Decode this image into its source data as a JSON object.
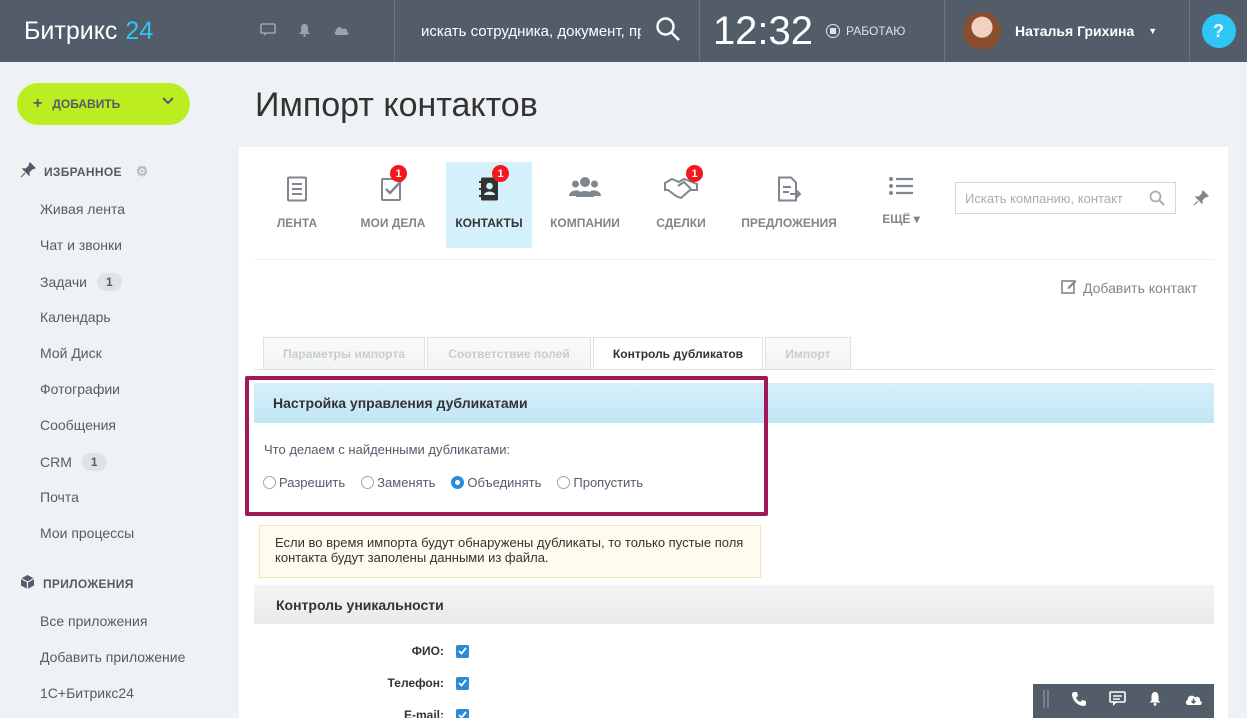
{
  "topbar": {
    "logo_text": "Битрикс",
    "logo_num": "24",
    "search_text": "искать сотрудника, документ, про",
    "time": "12:32",
    "status": "РАБОТАЮ",
    "user_name": "Наталья Грихина",
    "help": "?"
  },
  "sidebar": {
    "add_button": "ДОБАВИТЬ",
    "favorites_title": "ИЗБРАННОЕ",
    "favorites": [
      {
        "label": "Живая лента"
      },
      {
        "label": "Чат и звонки"
      },
      {
        "label": "Задачи",
        "count": "1"
      },
      {
        "label": "Календарь"
      },
      {
        "label": "Мой Диск"
      },
      {
        "label": "Фотографии"
      },
      {
        "label": "Сообщения"
      },
      {
        "label": "CRM",
        "count": "1"
      },
      {
        "label": "Почта"
      },
      {
        "label": "Мои процессы"
      }
    ],
    "apps_title": "ПРИЛОЖЕНИЯ",
    "apps": [
      {
        "label": "Все приложения"
      },
      {
        "label": "Добавить приложение"
      },
      {
        "label": "1С+Битрикс24"
      }
    ]
  },
  "page": {
    "title": "Импорт контактов"
  },
  "crm_tabs": [
    {
      "label": "ЛЕНТА"
    },
    {
      "label": "МОИ ДЕЛА",
      "badge": "1"
    },
    {
      "label": "КОНТАКТЫ",
      "badge": "1"
    },
    {
      "label": "КОМПАНИИ"
    },
    {
      "label": "СДЕЛКИ",
      "badge": "1"
    },
    {
      "label": "ПРЕДЛОЖЕНИЯ"
    },
    {
      "label": "ЕЩЁ ▾"
    }
  ],
  "crm_search_placeholder": "Искать компанию, контакт",
  "add_contact": "Добавить контакт",
  "steps": [
    {
      "label": "Параметры импорта"
    },
    {
      "label": "Соответствие полей"
    },
    {
      "label": "Контроль дубликатов"
    },
    {
      "label": "Импорт"
    }
  ],
  "duplicates": {
    "title": "Настройка управления дубликатами",
    "question": "Что делаем с найденными дубликатами:",
    "options": [
      {
        "label": "Разрешить"
      },
      {
        "label": "Заменять"
      },
      {
        "label": "Объединять"
      },
      {
        "label": "Пропустить"
      }
    ],
    "selected": "Объединять",
    "note": "Если во время импорта будут обнаружены дубликаты, то только пустые поля контакта будут заполены данными из файла."
  },
  "uniqueness": {
    "title": "Контроль уникальности",
    "fields": [
      {
        "label": "ФИО:",
        "checked": true
      },
      {
        "label": "Телефон:",
        "checked": true
      },
      {
        "label": "E-mail:",
        "checked": true
      }
    ]
  },
  "colors": {
    "topbar": "#535c69",
    "accent": "#2fc6f6",
    "add_button": "#bbed21",
    "highlight_frame": "#a0175a",
    "badge": "#f5161e"
  }
}
